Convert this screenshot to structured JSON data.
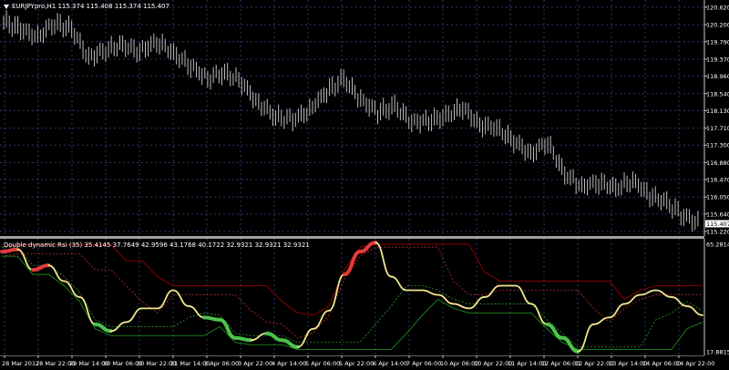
{
  "price_chart": {
    "symbol": "EURJPYpro,H1",
    "ohlc": [
      "115.374",
      "115.408",
      "115.374",
      "115.407"
    ],
    "current_price": "115.407",
    "y_axis_labels": [
      "120.620",
      "120.200",
      "119.790",
      "119.370",
      "118.960",
      "118.540",
      "118.130",
      "117.710",
      "117.300",
      "116.880",
      "116.470",
      "116.050",
      "115.640",
      "115.220"
    ]
  },
  "indicator": {
    "name": "Double dynamic Rsi (35)",
    "values": [
      "35.4145",
      "37.7649",
      "42.9596",
      "43.1768",
      "40.1722",
      "32.9321",
      "32.9321",
      "32.9321"
    ],
    "y_axis_labels": [
      "65.2814",
      "17.8815"
    ]
  },
  "time_axis": {
    "labels": [
      "28 Mar 2017",
      "28 Mar 22:00",
      "29 Mar 14:00",
      "30 Mar 06:00",
      "30 Mar 22:00",
      "31 Mar 14:00",
      "3 Apr 06:00",
      "3 Apr 22:00",
      "4 Apr 14:00",
      "5 Apr 06:00",
      "5 Apr 22:00",
      "6 Apr 14:00",
      "7 Apr 06:00",
      "10 Apr 06:00",
      "10 Apr 22:00",
      "11 Apr 14:00",
      "12 Apr 06:00",
      "12 Apr 22:00",
      "13 Apr 14:00",
      "14 Apr 06:00",
      "14 Apr 22:00"
    ]
  },
  "chart_data": [
    {
      "type": "line",
      "title": "EURJPYpro,H1",
      "ylim": [
        115.22,
        120.62
      ],
      "series": [
        {
          "values": [
            120.3,
            120.1,
            119.9,
            120.25,
            120.1,
            119.4,
            119.6,
            119.7,
            119.55,
            119.8,
            119.5,
            119.2,
            118.9,
            119.05,
            118.8,
            118.3,
            118.0,
            117.9,
            118.15,
            118.6,
            118.9,
            118.4,
            118.1,
            118.25,
            117.85,
            117.9,
            118.0,
            118.2,
            117.8,
            117.7,
            117.4,
            117.1,
            117.35,
            116.6,
            116.3,
            116.4,
            116.25,
            116.45,
            116.1,
            115.9,
            115.6,
            115.4
          ]
        }
      ]
    },
    {
      "type": "line",
      "title": "Double dynamic Rsi (35)",
      "ylim": [
        17.8815,
        65.2814
      ],
      "series": [
        {
          "values": [
            62,
            63,
            54,
            56,
            49,
            42,
            30,
            27,
            31,
            37,
            37,
            45,
            38,
            33,
            32,
            24,
            23,
            26,
            23,
            20,
            28,
            36,
            52,
            62,
            66,
            51,
            45,
            45,
            43,
            39,
            37,
            42,
            47,
            47,
            39,
            30,
            24,
            18,
            30,
            33,
            39,
            43,
            45,
            42,
            38,
            34
          ]
        }
      ]
    }
  ]
}
